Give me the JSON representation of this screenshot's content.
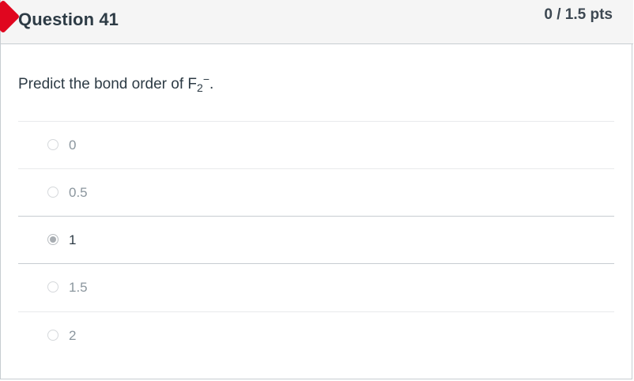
{
  "question": {
    "title": "Question 41",
    "points": "0 / 1.5 pts",
    "prompt_prefix": "Predict the bond order of F",
    "prompt_subscript": "2",
    "prompt_superscript": "−",
    "prompt_suffix": "."
  },
  "answers": [
    {
      "label": "0",
      "selected": false
    },
    {
      "label": "0.5",
      "selected": false
    },
    {
      "label": "1",
      "selected": true
    },
    {
      "label": "1.5",
      "selected": false
    },
    {
      "label": "2",
      "selected": false
    }
  ],
  "colors": {
    "flag": "#e0061f",
    "header_bg": "#f5f5f5",
    "text": "#2d3b45",
    "muted_text": "#8b969e",
    "divider": "#e8eaec"
  }
}
